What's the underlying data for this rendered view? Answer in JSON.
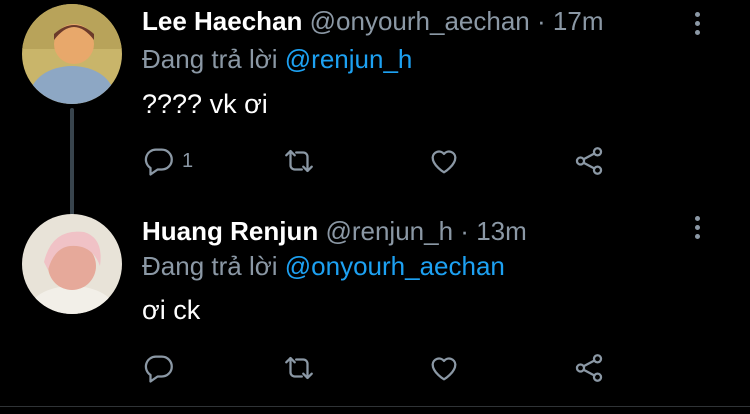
{
  "tweets": [
    {
      "name": "Lee Haechan",
      "handle": "@onyourh_aechan",
      "separator": "·",
      "time": "17m",
      "replying_prefix": "Đang trả lời ",
      "replying_to": "@renjun_h",
      "text": "???? vk ơi",
      "reply_count": "1",
      "avatar_colors": [
        "#c9b56a",
        "#8da7c4",
        "#e8a86b"
      ]
    },
    {
      "name": "Huang Renjun",
      "handle": "@renjun_h",
      "separator": "·",
      "time": "13m",
      "replying_prefix": "Đang trả lời ",
      "replying_to": "@onyourh_aechan",
      "text": "ơi ck",
      "reply_count": "",
      "avatar_colors": [
        "#f0c2c6",
        "#e8e3d8",
        "#e6a99a"
      ]
    }
  ],
  "icons": [
    "reply-icon",
    "retweet-icon",
    "like-icon",
    "share-icon",
    "more-icon"
  ],
  "colors": {
    "background": "#000000",
    "name": "#ffffff",
    "muted": "#8b98a5",
    "link": "#1da1f2",
    "thread_line": "#38444d"
  }
}
